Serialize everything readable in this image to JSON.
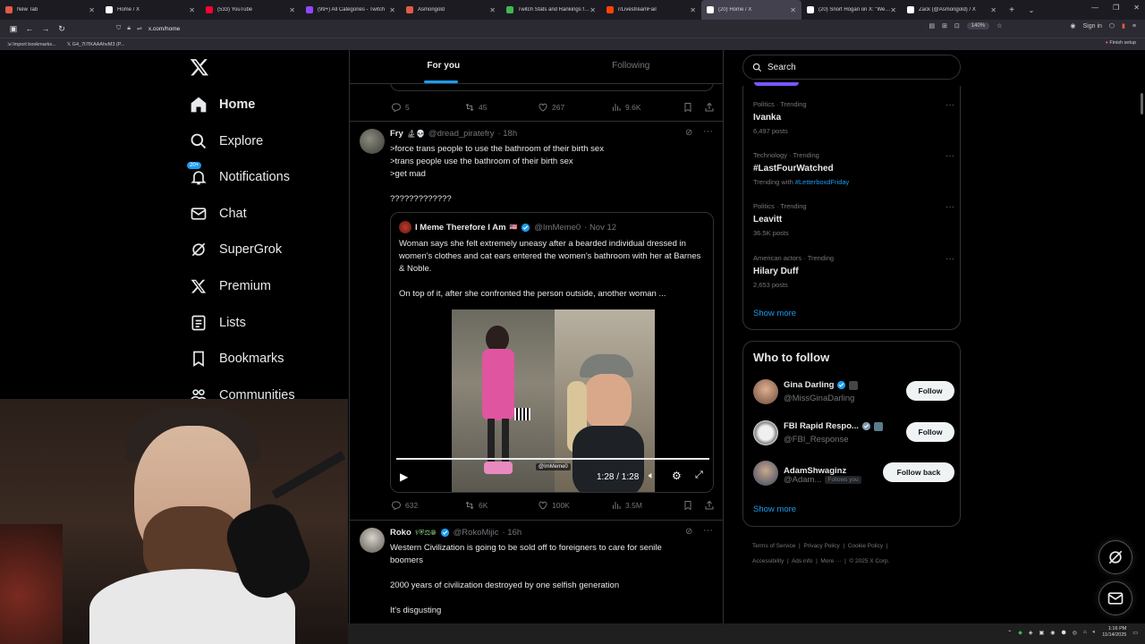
{
  "browser": {
    "tabs": [
      {
        "title": "New Tab",
        "color": "#e05b49"
      },
      {
        "title": "Home / X",
        "color": "#ffffff"
      },
      {
        "title": "(533) YouTube",
        "color": "#ff0033"
      },
      {
        "title": "(99+) All Categories - Twitch",
        "color": "#9146ff"
      },
      {
        "title": "Asmongold",
        "color": "#e05b49"
      },
      {
        "title": "Twitch Stats and Rankings for C",
        "color": "#3fb950"
      },
      {
        "title": "r/LivestreamFail",
        "color": "#ff4500"
      },
      {
        "title": "(20) Home / X",
        "color": "#ffffff",
        "active": true
      },
      {
        "title": "(20) Snort Hogan on X: \"We mu",
        "color": "#ffffff"
      },
      {
        "title": "Zack (@Asmongold) / X",
        "color": "#ffffff"
      }
    ],
    "url": "x.com/home",
    "zoom": "140%",
    "sign_in": "Sign in",
    "bookmarks": [
      "Import bookmarks...",
      "G4_7t7fXAAAhvM3 (P..."
    ],
    "finish_setup": "Finish setup"
  },
  "nav": {
    "items": [
      {
        "label": "Home",
        "icon": "home-icon"
      },
      {
        "label": "Explore",
        "icon": "search-icon"
      },
      {
        "label": "Notifications",
        "icon": "bell-icon",
        "badge": "20+"
      },
      {
        "label": "Chat",
        "icon": "mail-icon"
      },
      {
        "label": "SuperGrok",
        "icon": "grok-icon"
      },
      {
        "label": "Premium",
        "icon": "x-logo-icon"
      },
      {
        "label": "Lists",
        "icon": "list-icon"
      },
      {
        "label": "Bookmarks",
        "icon": "bookmark-icon"
      },
      {
        "label": "Communities",
        "icon": "people-icon"
      }
    ]
  },
  "feed": {
    "tabs": [
      "For you",
      "Following"
    ],
    "prev_post_actions": {
      "replies": "5",
      "reposts": "45",
      "likes": "267",
      "views": "9.6K"
    },
    "post1": {
      "name": "Fry",
      "handle": "@dread_piratefry",
      "time": "· 18h",
      "lines": [
        ">force trans people to use the bathroom of their birth sex",
        ">trans people use the bathroom of their birth sex",
        ">get mad",
        "",
        "?????????????"
      ],
      "quote": {
        "name": "I Meme Therefore I Am",
        "handle": "@ImMeme0",
        "time": "· Nov 12",
        "text": "Woman says she felt extremely uneasy after a bearded individual dressed in women's clothes and cat ears entered the women's bathroom with her at Barnes & Noble.",
        "text2": "On top of it, after she confronted the person outside, another woman ...",
        "video_time": "1:28 / 1:28",
        "watermark": "@ImMeme0"
      },
      "actions": {
        "replies": "632",
        "reposts": "6K",
        "likes": "100K",
        "views": "3.5M"
      }
    },
    "post2": {
      "name": "Roko",
      "handle": "@RokoMijic",
      "time": "· 16h",
      "lines": [
        "Western Civilization is going to be sold off to foreigners to care for senile",
        "boomers",
        "",
        "2000 years of civilization destroyed by one selfish generation",
        "",
        "It's disgusting"
      ]
    }
  },
  "sidebar": {
    "search_placeholder": "Search",
    "trends": [
      {
        "meta": "Politics · Trending",
        "name": "Ivanka",
        "count": "6,497 posts"
      },
      {
        "meta": "Technology · Trending",
        "name": "#LastFourWatched",
        "count_prefix": "Trending with",
        "count_link": "#LetterboxdFriday"
      },
      {
        "meta": "Politics · Trending",
        "name": "Leavitt",
        "count": "36.5K posts"
      },
      {
        "meta": "American actors · Trending",
        "name": "Hilary Duff",
        "count": "2,653 posts"
      }
    ],
    "show_more": "Show more",
    "who_to_follow": {
      "title": "Who to follow",
      "users": [
        {
          "name": "Gina Darling",
          "handle": "@MissGinaDarling",
          "button": "Follow"
        },
        {
          "name": "FBI Rapid Respo...",
          "handle": "@FBI_Response",
          "button": "Follow"
        },
        {
          "name": "AdamShwaginz",
          "handle": "@Adam...",
          "follows_you": "Follows you",
          "button": "Follow back"
        }
      ],
      "show_more": "Show more"
    },
    "footer": {
      "row1": [
        "Terms of Service",
        "Privacy Policy",
        "Cookie Policy"
      ],
      "row2": [
        "Accessibility",
        "Ads info",
        "More ···",
        "© 2025 X Corp."
      ]
    }
  },
  "taskbar": {
    "time": "1:16 PM",
    "date": "11/14/2025"
  }
}
